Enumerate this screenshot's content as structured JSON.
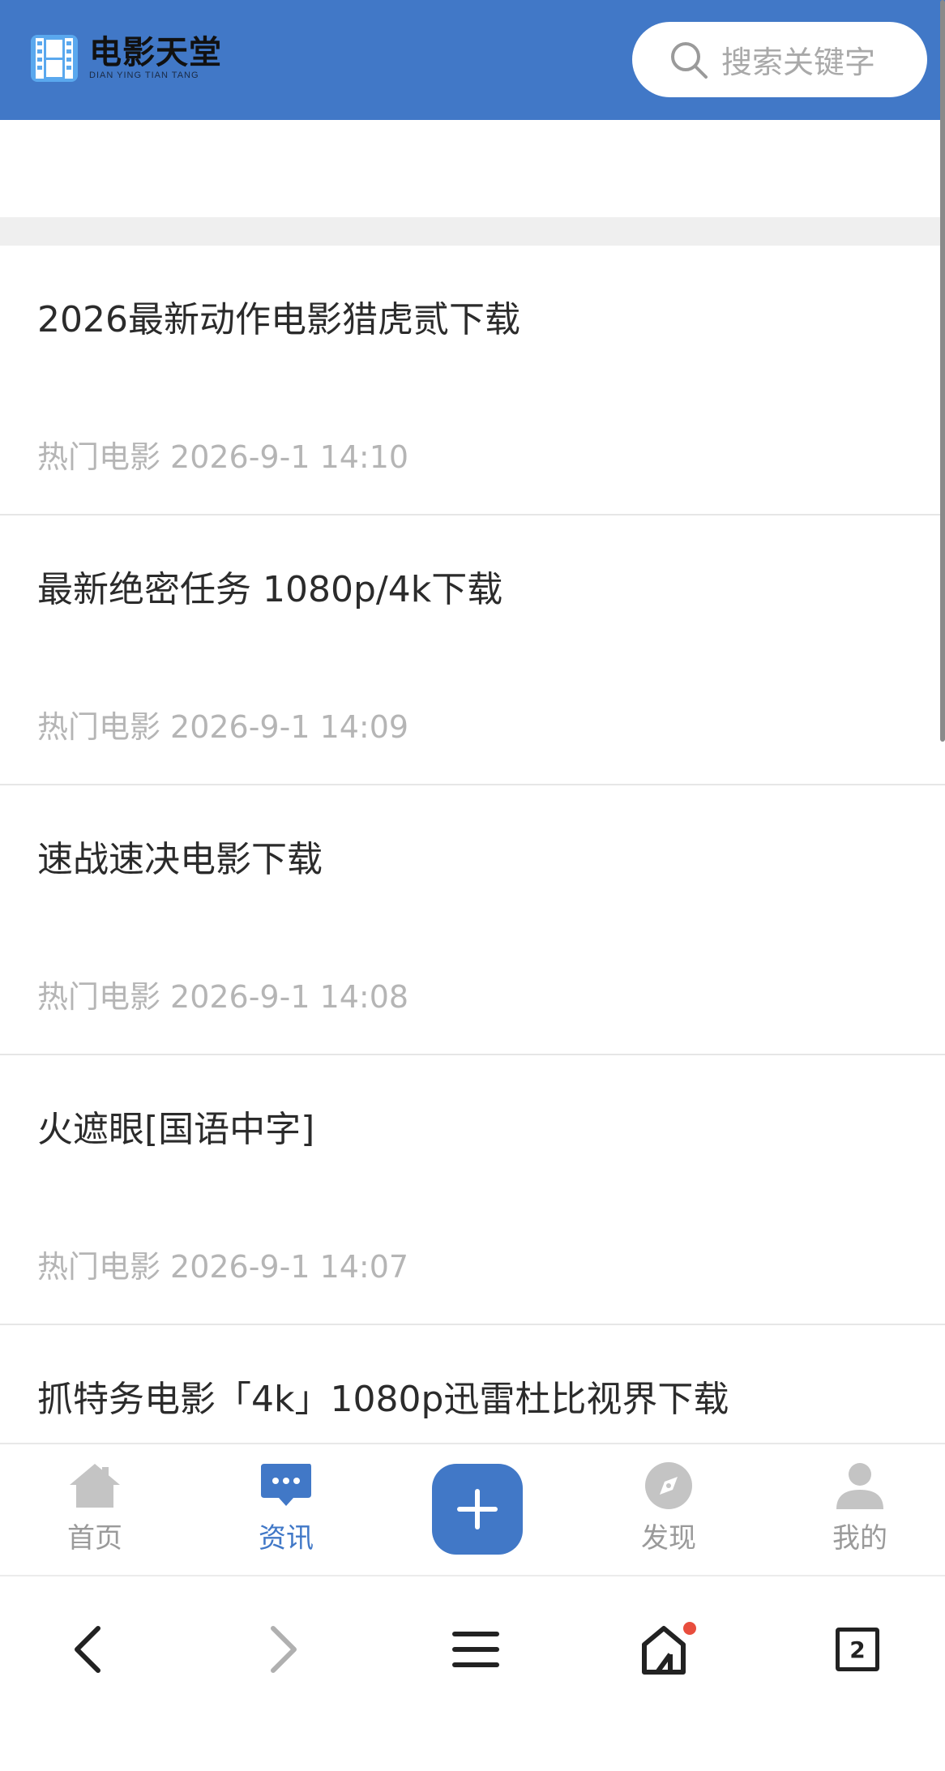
{
  "header": {
    "logo_title": "电影天堂",
    "logo_subtitle": "DIAN YING TIAN TANG",
    "search_placeholder": "搜索关键字",
    "brand_color": "#4178c7"
  },
  "articles": [
    {
      "title": "2026最新动作电影猎虎贰下载",
      "category": "热门电影",
      "time": "2026-9-1 14:10"
    },
    {
      "title": "最新绝密任务 1080p/4k下载",
      "category": "热门电影",
      "time": "2026-9-1 14:09"
    },
    {
      "title": "速战速决电影下载",
      "category": "热门电影",
      "time": "2026-9-1 14:08"
    },
    {
      "title": "火遮眼[国语中字]",
      "category": "热门电影",
      "time": "2026-9-1 14:07"
    },
    {
      "title": "抓特务电影「4k」1080p迅雷杜比视界下载",
      "category": "",
      "time": ""
    }
  ],
  "tabbar": {
    "home": "首页",
    "news": "资讯",
    "discover": "发现",
    "mine": "我的",
    "active": "资讯"
  },
  "browser": {
    "tab_count": "2",
    "icons": [
      "back-icon",
      "forward-icon",
      "menu-icon",
      "home-icon",
      "tabs-icon"
    ]
  }
}
